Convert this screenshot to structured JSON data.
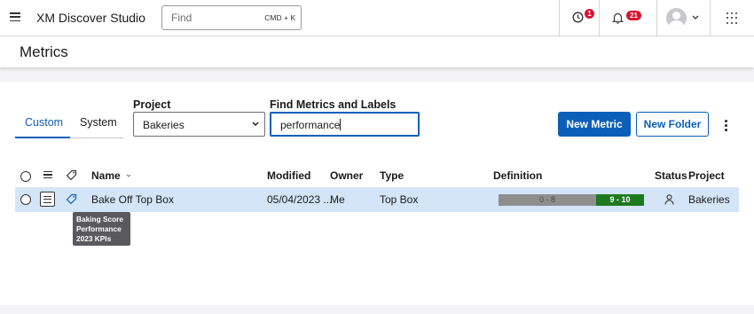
{
  "topbar": {
    "app_title": "XM Discover Studio",
    "search_placeholder": "Find",
    "search_shortcut": "CMD + K",
    "history_badge": "1",
    "notifications_badge": "21"
  },
  "page": {
    "title": "Metrics"
  },
  "tabs": [
    {
      "label": "Custom",
      "active": true
    },
    {
      "label": "System",
      "active": false
    }
  ],
  "filters": {
    "project_label": "Project",
    "project_value": "Bakeries",
    "find_label": "Find Metrics and Labels",
    "find_value": "performance"
  },
  "actions": {
    "new_metric": "New Metric",
    "new_folder": "New Folder"
  },
  "table": {
    "columns": {
      "name": "Name",
      "modified": "Modified",
      "owner": "Owner",
      "type": "Type",
      "definition": "Definition",
      "status": "Status",
      "project": "Project"
    },
    "rows": [
      {
        "name": "Bake Off Top Box",
        "modified": "05/04/2023 ...",
        "owner": "Me",
        "type": "Top Box",
        "definition_low": "0 - 8",
        "definition_high": "9 - 10",
        "project": "Bakeries"
      }
    ]
  },
  "tooltip": {
    "lines": [
      "Baking Score",
      "Performance",
      "2023 KPIs"
    ]
  },
  "colors": {
    "accent": "#0b5fb8",
    "selected_row": "#d4e5f7",
    "badge": "#d9132f",
    "definition_low": "#8e8e8e",
    "definition_high": "#1e7a1e"
  }
}
